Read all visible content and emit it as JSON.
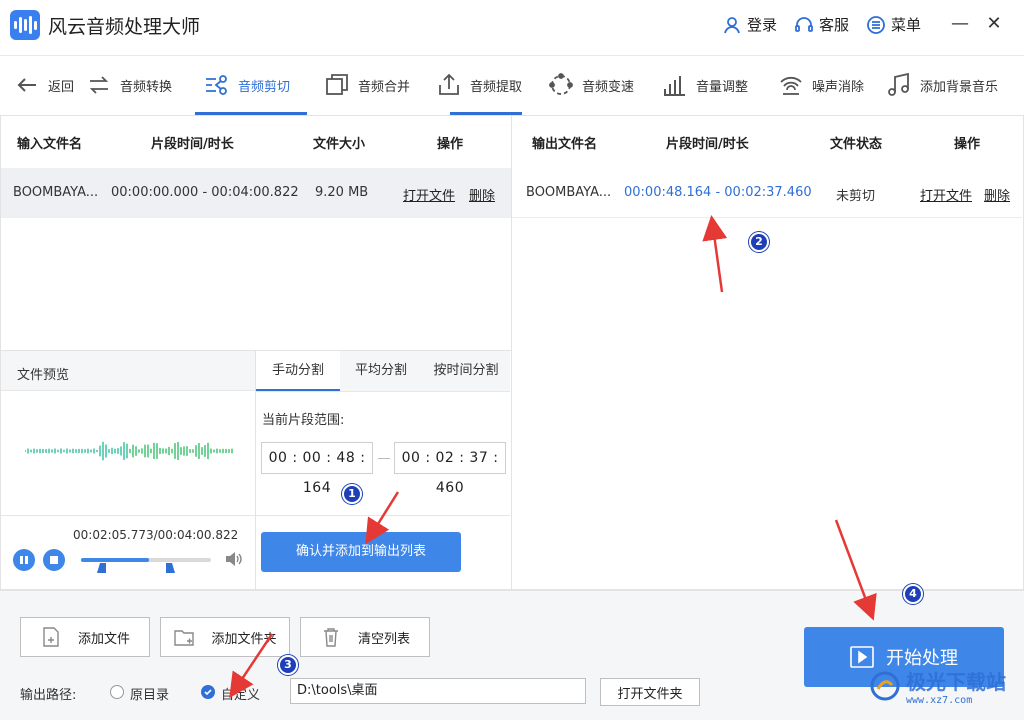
{
  "app": {
    "title": "风云音频处理大师"
  },
  "titlebar": {
    "login": "登录",
    "service": "客服",
    "menu": "菜单",
    "minimize": "—",
    "close": "✕"
  },
  "nav": {
    "back": "返回",
    "items": [
      "音频转换",
      "音频剪切",
      "音频合并",
      "音频提取",
      "音频变速",
      "音量调整",
      "噪声消除",
      "添加背景音乐"
    ],
    "active_index": 1
  },
  "input_table": {
    "headers": [
      "输入文件名",
      "片段时间/时长",
      "文件大小",
      "操作"
    ],
    "rows": [
      {
        "name": "BOOMBAYA...",
        "range": "00:00:00.000 - 00:04:00.822",
        "size": "9.20 MB",
        "open": "打开文件",
        "delete": "删除"
      }
    ]
  },
  "output_table": {
    "headers": [
      "输出文件名",
      "片段时间/时长",
      "文件状态",
      "操作"
    ],
    "rows": [
      {
        "name": "BOOMBAYA...",
        "range": "00:00:48.164 - 00:02:37.460",
        "status": "未剪切",
        "open": "打开文件",
        "delete": "删除"
      }
    ]
  },
  "preview": {
    "title": "文件预览",
    "time": "00:02:05.773/00:04:00.822",
    "progress": 0.52
  },
  "split": {
    "tabs": [
      "手动分割",
      "平均分割",
      "按时间分割"
    ],
    "active_tab": 0,
    "range_label": "当前片段范围:",
    "start": "00 : 00 : 48 : 164",
    "end": "00 : 02 : 37 : 460",
    "confirm": "确认并添加到输出列表"
  },
  "bottom": {
    "add_file": "添加文件",
    "add_folder": "添加文件夹",
    "clear_list": "清空列表",
    "output_path_label": "输出路径:",
    "option_original": "原目录",
    "option_custom": "自定义",
    "path_value": "D:\\tools\\桌面",
    "open_folder": "打开文件夹",
    "start": "开始处理"
  },
  "annotations": [
    "1",
    "2",
    "3",
    "4"
  ],
  "watermark": {
    "text": "极光下载站",
    "sub": "www.xz7.com"
  },
  "colors": {
    "accent": "#2f6fd6",
    "primary_button": "#3e86e8",
    "annotation_arrow": "#e53935",
    "badge": "#1d3fb8"
  }
}
